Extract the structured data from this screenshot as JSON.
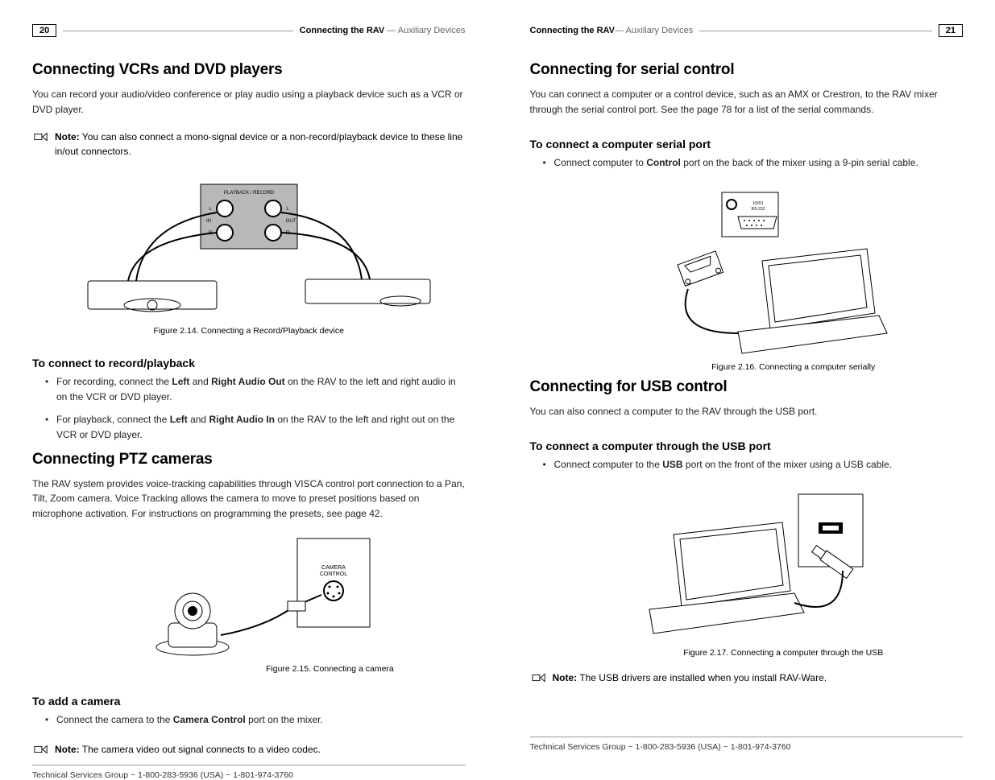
{
  "left": {
    "pageNum": "20",
    "headerStrong": "Connecting the RAV",
    "headerLight": "  —  Auxiliary Devices",
    "h1a": "Connecting VCRs and DVD players",
    "p1": "You can record your audio/video conference or play audio using a playback device such as a VCR or DVD player.",
    "noteLabel": "Note:",
    "note1": " You can also connect a mono-signal device or a non-record/playback device to these line in/out connectors.",
    "fig14cap": "Figure 2.14. Connecting a Record/Playback device",
    "h2a": "To connect to record/playback",
    "li1a": "For recording, connect the ",
    "li1b": "Left",
    "li1c": " and ",
    "li1d": "Right Audio Out",
    "li1e": " on the RAV to the left and right audio in on the VCR or DVD player.",
    "li2a": "For playback, connect the ",
    "li2b": "Left",
    "li2c": " and ",
    "li2d": "Right Audio In",
    "li2e": " on the RAV to the left and right out on the VCR or DVD player.",
    "h1b": "Connecting PTZ cameras",
    "p2": "The RAV system provides voice-tracking capabilities through VISCA control port connection to a Pan, Tilt, Zoom camera. Voice Tracking allows the camera to move to preset positions based on microphone activation. For instructions on programming the presets, see page 42.",
    "fig15cap": "Figure 2.15. Connecting a camera",
    "h2b": "To add a camera",
    "li3a": "Connect the camera to the ",
    "li3b": "Camera Control",
    "li3c": " port on the mixer.",
    "note2": " The camera video out signal connects to a video codec.",
    "footer": "Technical Services Group ~ 1-800-283-5936 (USA) ~ 1-801-974-3760"
  },
  "right": {
    "pageNum": "21",
    "headerStrong": "Connecting the RAV",
    "headerLight": "—  Auxiliary Devices",
    "h1a": "Connecting for serial control",
    "p1": "You can connect a computer or a control device, such as an AMX or Crestron, to the RAV mixer through the serial control port. See the page 78 for a list of the serial commands.",
    "h2a": "To connect a computer serial port",
    "li1a": "Connect computer to ",
    "li1b": "Control",
    "li1c": " port on the back of the mixer using a 9-pin serial cable.",
    "fig16cap": "Figure 2.16. Connecting a computer serially",
    "h1b": "Connecting for USB control",
    "p2": "You can also connect a computer to the RAV through the USB port.",
    "h2b": "To connect a computer through the USB port",
    "li2a": "Connect computer to the ",
    "li2b": "USB",
    "li2c": " port on the front of the mixer using a USB cable.",
    "fig17cap": "Figure 2.17. Connecting a computer through the USB",
    "noteLabel": "Note:",
    "note1": " The USB drivers are installed when you install RAV-Ware.",
    "footer": "Technical Services Group ~ 1-800-283-5936 (USA) ~ 1-801-974-3760"
  }
}
